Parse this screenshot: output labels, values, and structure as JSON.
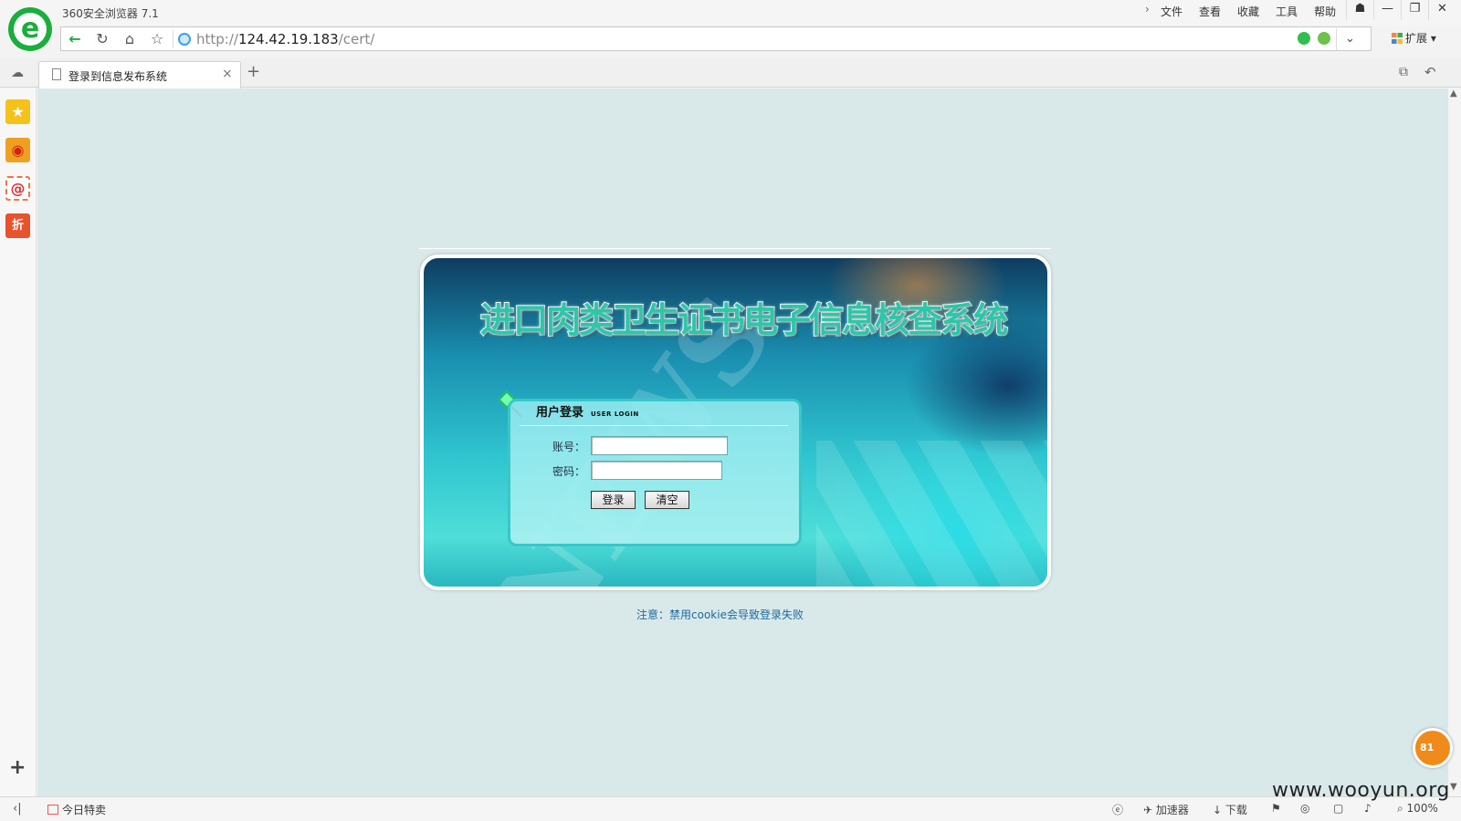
{
  "browser": {
    "app_title": "360安全浏览器 7.1",
    "menu": [
      "文件",
      "查看",
      "收藏",
      "工具",
      "帮助"
    ],
    "url_prefix": "http://",
    "url_host": "124.42.19.183",
    "url_path": "/cert/",
    "extensions_label": "扩展",
    "tab_title": "登录到信息发布系统",
    "new_tab": "+",
    "statusbar": {
      "deal_label": "今日特卖",
      "accelerator_label": "加速器",
      "download_label": "下载",
      "zoom": "100%"
    },
    "badge_count": "81",
    "watermark": "www.wooyun.org"
  },
  "icons": {
    "back": "back-arrow-icon",
    "refresh": "refresh-icon",
    "home": "home-icon",
    "favorite": "star-icon",
    "sidebar": [
      "favorites-star-icon",
      "weibo-icon",
      "mail-at-icon",
      "sale-discount-icon"
    ]
  },
  "page": {
    "system_title": "进口肉类卫生证书电子信息核查系统",
    "watermark_text": "NEWS",
    "login": {
      "title": "用户登录",
      "subtitle": "USER LOGIN",
      "account_label": "账号：",
      "account_value": "",
      "password_label": "密码：",
      "password_value": "",
      "login_button": "登录",
      "clear_button": "清空"
    },
    "notice": "注意：禁用cookie会导致登录失败"
  },
  "colors": {
    "page_background": "#d9e9ea",
    "brand_green": "#1aae3c",
    "title_teal": "#2fc6a8",
    "notice_blue": "#1e6aa0"
  }
}
